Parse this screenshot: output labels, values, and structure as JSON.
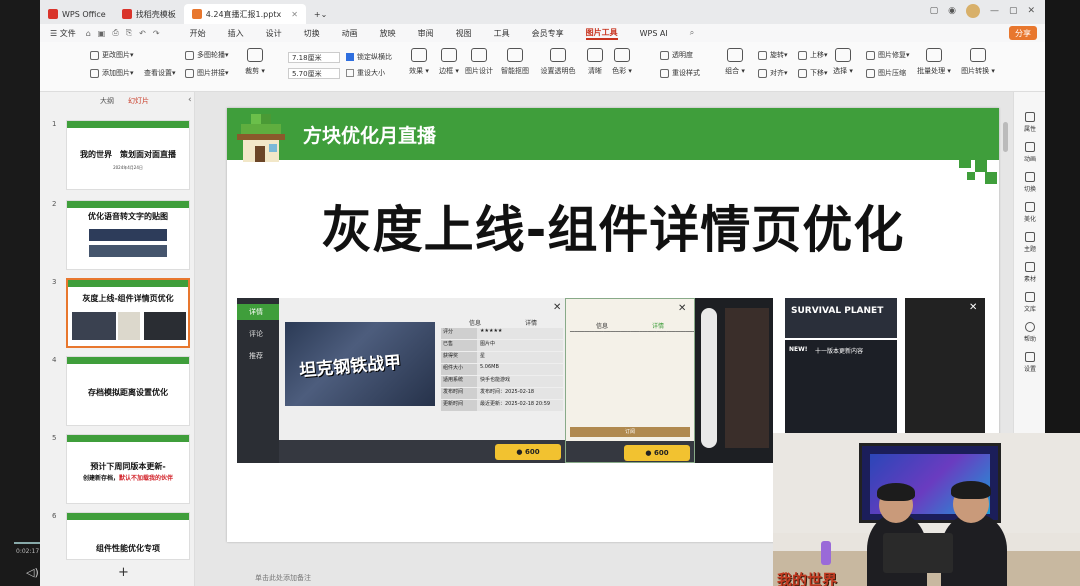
{
  "titlebar": {
    "tabs": [
      {
        "label": "WPS Office",
        "color": "#d9342b"
      },
      {
        "label": "找稻壳模板",
        "color": "#d9342b"
      },
      {
        "label": "4.24直播汇报1.pptx",
        "color": "#e8772e"
      }
    ],
    "add_tab": "+"
  },
  "menubar": {
    "file": "文件",
    "items": [
      "开始",
      "插入",
      "设计",
      "切换",
      "动画",
      "放映",
      "审阅",
      "视图",
      "工具",
      "会员专享",
      "图片工具",
      "WPS AI"
    ],
    "active": "图片工具",
    "share": "分享"
  },
  "ribbon": {
    "change_pic": "更改图片",
    "add_pic": "添加图片",
    "multi_crop": "多图轮播",
    "pic_stitch": "图片拼接",
    "view_settings": "查看设置",
    "crop": "裁剪",
    "width": "7.18厘米",
    "height": "5.70厘米",
    "lock_ratio": "锁定纵横比",
    "reset_size": "重设大小",
    "effects": "效果",
    "border": "边框",
    "pic_design": "图片设计",
    "smart_crop": "智能抠图",
    "transparency": "设置透明色",
    "clarify": "清晰",
    "color": "色彩",
    "transparent": "透明度",
    "reset_style": "重设样式",
    "combine": "组合",
    "rotate": "旋转",
    "align": "对齐",
    "up": "上移",
    "down": "下移",
    "select": "选择",
    "pic_compress": "图片修复",
    "pic_size": "图片压缩",
    "batch": "批量处理",
    "pic_convert": "图片转换"
  },
  "left_panel": {
    "tab_outline": "大纲",
    "tab_slides": "幻灯片",
    "slides": [
      {
        "num": "1",
        "title_a": "我的世界",
        "title_b": "策划面对面直播",
        "sub": "2024年4月24日"
      },
      {
        "num": "2",
        "title_a": "优化语音转文字的贴图",
        "title_b": "",
        "sub": ""
      },
      {
        "num": "3",
        "title_a": "灰度上线-组件详情页优化",
        "title_b": "",
        "sub": ""
      },
      {
        "num": "4",
        "title_a": "存档模拟距离设置优化",
        "title_b": "",
        "sub": ""
      },
      {
        "num": "5",
        "title_a": "预计下周同版本更新-",
        "title_b": "创建新存档，",
        "title_c": "默认不加载我的伙伴",
        "sub": ""
      },
      {
        "num": "6",
        "title_a": "组件性能优化专项",
        "title_b": "",
        "sub": ""
      }
    ],
    "add": "+"
  },
  "slide": {
    "banner": "方块优化月直播",
    "title": "灰度上线-组件详情页优化",
    "ss1": {
      "side": [
        "详情",
        "评论",
        "推荐"
      ],
      "game_title": "坦克钢铁战甲",
      "tabs": [
        "信息",
        "详情"
      ],
      "rows": [
        [
          "评分",
          "★★★★★"
        ],
        [
          "已售",
          "图片中"
        ],
        [
          "获得奖",
          "星"
        ],
        [
          "组件大小",
          "5.06MB"
        ],
        [
          "适用系统",
          "快手也能游戏"
        ],
        [
          "发布时间",
          "发布时间：2025-02-18"
        ],
        [
          "更新时间",
          "最近更新：2025-02-18 20:59"
        ]
      ],
      "price": "600"
    },
    "ss2": {
      "tabs": [
        "信息",
        "详情"
      ],
      "price": "600",
      "btn": "订阅"
    },
    "ss4": {
      "survival": "SURVIVAL PLANET",
      "new": "NEW!",
      "update": "十一版本更新内容"
    }
  },
  "notes": "单击此处添加备注",
  "right_sidebar": [
    "属性",
    "动画",
    "切换",
    "美化",
    "主题",
    "素材",
    "文库",
    "帮助",
    "设置"
  ],
  "webcam": {
    "logo": "我的世界"
  }
}
